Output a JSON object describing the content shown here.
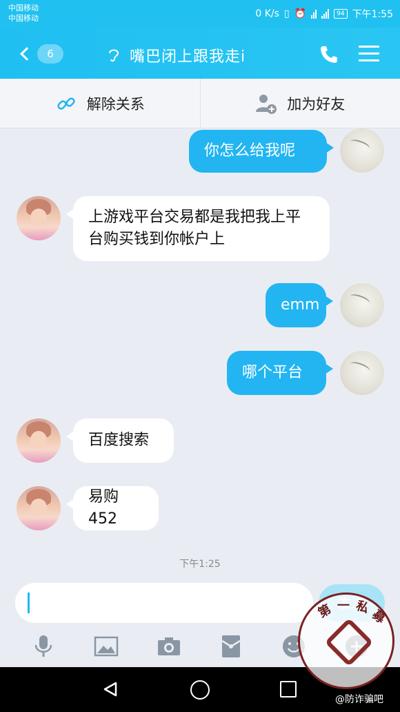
{
  "status_bar": {
    "carrier_1": "中国移动",
    "carrier_2": "中国移动",
    "net_speed": "0 K/s",
    "battery": "94",
    "time": "下午1:55"
  },
  "nav": {
    "back_badge": "6",
    "title": "嘴巴闭上跟我走i"
  },
  "actions": {
    "unlink_label": "解除关系",
    "add_friend_label": "加为好友"
  },
  "messages": [
    {
      "side": "out",
      "text": "你怎么给我呢"
    },
    {
      "side": "in",
      "text": "上游戏平台交易都是我把我上平台购买钱到你帐户上"
    },
    {
      "side": "out",
      "text": "emm"
    },
    {
      "side": "out",
      "text": "哪个平台"
    },
    {
      "side": "in",
      "text": "百度搜索"
    },
    {
      "side": "in",
      "text": "易购452"
    }
  ],
  "timestamp": "下午1:25",
  "composer": {
    "send_label": "发送"
  },
  "toolbar": {
    "icons": [
      "microphone-icon",
      "image-icon",
      "camera-icon",
      "red-packet-icon",
      "emoji-icon",
      "plus-icon"
    ]
  },
  "watermark": {
    "stamp_text": "第一私募",
    "caption": "@防诈骗吧"
  },
  "colors": {
    "accent": "#20c1f0",
    "outgoing_bubble": "#22b5f2",
    "incoming_bubble": "#ffffff",
    "background": "#e9edf3"
  }
}
